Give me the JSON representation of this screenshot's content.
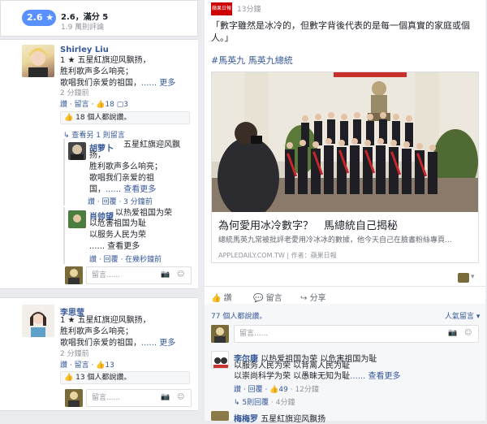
{
  "left": {
    "rating": {
      "score": "2.6 ★",
      "text": "2.6，滿分 5",
      "sub": "1.9 萬則評論"
    },
    "post1": {
      "name": "Shirley Liu",
      "lines": [
        "1 ★ 五星紅旗迎风飘扬，",
        "胜利歌声多么响亮；",
        "歌唱我们亲爱的祖国，"
      ],
      "more_text": "...... 更多",
      "time": "2 分鐘前",
      "actions": "讚 · 留言 · ",
      "like_count": "18",
      "comment_count": "3",
      "likes_summary": "18 個人都說讚。",
      "view_prev": "查看另 1 則留言",
      "replies": [
        {
          "name": "胡萝卜",
          "lines": [
            "五星紅旗迎风飘",
            "扬，",
            "胜利歌声多么响亮；",
            "歌唱我们亲爱的祖",
            "国，"
          ],
          "more": "...... 查看更多",
          "actions": "讚 · 回覆 · 3 分鐘前"
        },
        {
          "name": "肖帅望",
          "lines": [
            "以热爱祖国为荣",
            "以危害祖国为耻",
            "以服务人民为荣"
          ],
          "more": "...... 查看更多",
          "actions": "讚 · 回覆 · 在幾秒鐘前"
        }
      ],
      "input_placeholder": "留言......"
    },
    "post2": {
      "name": "李思莹",
      "lines": [
        "1 ★ 五星紅旗迎风飘扬，",
        "胜利歌声多么响亮；",
        "歌唱我们亲爱的祖国，"
      ],
      "more_text": "...... 更多",
      "time": "2 分鐘前",
      "actions": "讚 · 留言 · ",
      "like_count": "13",
      "likes_summary": "13 個人都說讚。",
      "input_placeholder": "留言......"
    }
  },
  "right": {
    "source_label": "蘋果日報",
    "time": "13分鐘",
    "quote": [
      "「數字雖然是冰冷的，但數字背後代表的是每一個真實的家庭或個",
      "人。」"
    ],
    "hashtags": "#馬英九 馬英九總統",
    "link": {
      "title": "為何愛用冰冷數字？　馬總統自己揭秘",
      "desc": "總統馬英九常被批評老愛用冷冰冰的數據，他今天自己在臉書粉絲專頁...",
      "source": "APPLEDAILY.COM.TW",
      "author": "作者：蘋果日報"
    },
    "actions": {
      "like": "讚",
      "comment": "留言",
      "share": "分享"
    },
    "likes_summary": "77 個人都說讚。",
    "sort_label": "人氣留言",
    "input_placeholder": "留言......",
    "comment1": {
      "name": "李尔康",
      "lines": [
        "以热爱祖国为荣 以危害祖国为耻",
        "以服务人民为荣 以背离人民为耻",
        "以崇尚科学为荣 以愚昧无知为耻"
      ],
      "more": "...... 查看更多",
      "actions": "讚 · 回覆 · ",
      "like_count": "49",
      "time": "· 12分鐘",
      "replies_link": "5則回覆",
      "replies_time": "· 4分鐘"
    },
    "comment2": {
      "name": "梅梅罗",
      "text": "五星紅旗迎风飘扬"
    }
  },
  "colors": {
    "accent": "#365899",
    "badge": "#5890ff",
    "bg": "#e9ebee"
  }
}
